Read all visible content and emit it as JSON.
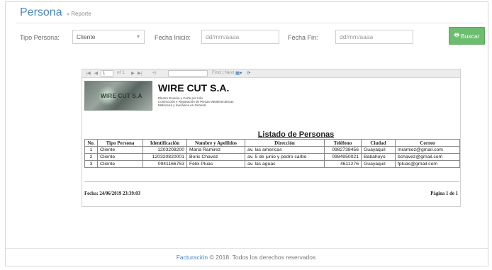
{
  "header": {
    "title": "Persona",
    "breadcrumb": "» Reporte"
  },
  "filters": {
    "tipo_persona_label": "Tipo Persona:",
    "tipo_persona_value": "Cliente",
    "fecha_inicio_label": "Fecha Inicio:",
    "fecha_inicio_placeholder": "dd/mm/aaaa",
    "fecha_fin_label": "Fecha Fin:",
    "fecha_fin_placeholder": "dd/mm/aaaa",
    "buscar_label": "Buscar"
  },
  "report_toolbar": {
    "page_value": "1",
    "page_of": "of 1",
    "find_next": "Find | Next"
  },
  "report": {
    "logo_text": "WIRE CUT S.A",
    "company": "WIRE CUT S.A.",
    "lines": [
      "Electro Erosión y Corte por Hilo",
      "Contrucción y Reparación de Piezas Metalmecánicas",
      "Matricería y mecánica en General"
    ],
    "list_title": "Listado de Personas",
    "columns": [
      "No.",
      "Tipo Persona",
      "Identificación",
      "Nombre y Apellidos",
      "Dirección",
      "Teléfono",
      "Ciudad",
      "Correo"
    ],
    "rows": [
      [
        "1",
        "Cliente",
        "1203208200",
        "Maria Ramirez",
        "av. las americas",
        "0982738456",
        "Guayaquil",
        "mramiez@gmail.com"
      ],
      [
        "2",
        "Cliente",
        "120320820001",
        "Boris Chavez",
        "av. 5 de junio y pedro carbo",
        "0984950021",
        "Babahoyo",
        "bchavez@gmail.com"
      ],
      [
        "3",
        "Cliente",
        "0941166753",
        "Felix Pluas",
        "av. las aguas",
        "4611276",
        "Guayaquil",
        "fpluas@gmail.com"
      ]
    ],
    "fecha": "Fecha: 24/06/2019 23:39:03",
    "pagina": "Página 1 de 1"
  },
  "footer": {
    "brand": "Facturación",
    "text": "© 2018. Todos los derechos reservados"
  },
  "colors": {
    "accent": "#4a86c5",
    "button": "#6dbd6f"
  },
  "icons": {
    "buscar": "print-icon",
    "select": "chevron-down-icon"
  }
}
